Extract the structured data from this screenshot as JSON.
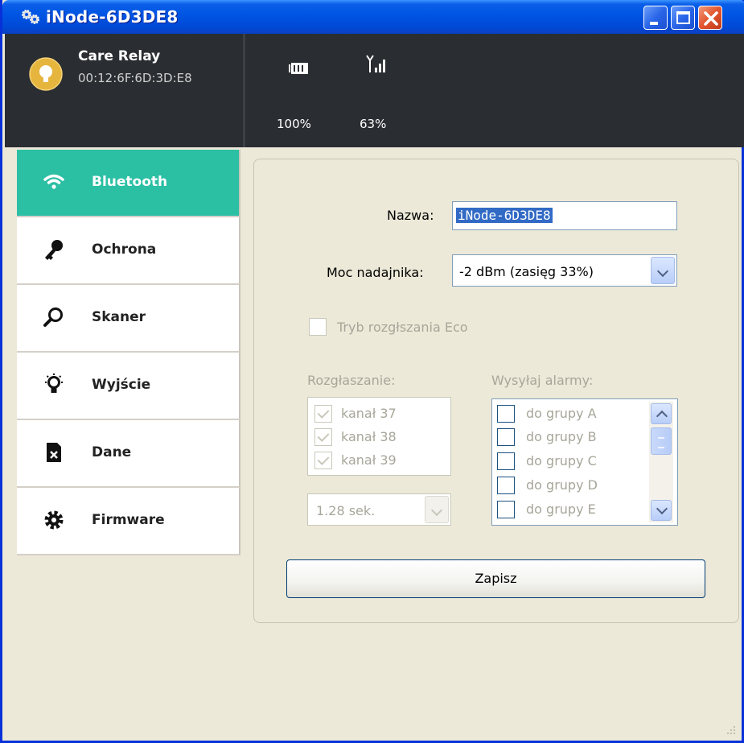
{
  "window": {
    "title": "iNode-6D3DE8"
  },
  "device": {
    "name": "Care Relay",
    "mac": "00:12:6F:6D:3D:E8"
  },
  "status": {
    "battery": "100%",
    "signal": "63%"
  },
  "sidebar": {
    "items": [
      {
        "label": "Bluetooth",
        "icon": "wifi-icon",
        "active": true
      },
      {
        "label": "Ochrona",
        "icon": "key-icon"
      },
      {
        "label": "Skaner",
        "icon": "magnifier-icon"
      },
      {
        "label": "Wyjście",
        "icon": "lightbulb-icon"
      },
      {
        "label": "Dane",
        "icon": "file-x-icon"
      },
      {
        "label": "Firmware",
        "icon": "gear-icon"
      }
    ]
  },
  "form": {
    "name_label": "Nazwa:",
    "name_value": "iNode-6D3DE8",
    "power_label": "Moc nadajnika:",
    "power_value": "-2 dBm  (zasięg 33%)",
    "eco_label": "Tryb rozgłszania Eco",
    "broadcast_label": "Rozgłaszanie:",
    "channels": [
      "kanał 37",
      "kanał 38",
      "kanał 39"
    ],
    "interval_value": "1.28 sek.",
    "alarms_label": "Wysyłaj alarmy:",
    "groups": [
      "do grupy A",
      "do grupy B",
      "do grupy C",
      "do grupy D",
      "do grupy E"
    ],
    "save_label": "Zapisz"
  },
  "colors": {
    "accent": "#2bbfa4",
    "header": "#2a2d31",
    "titlebar": "#0054e3"
  }
}
